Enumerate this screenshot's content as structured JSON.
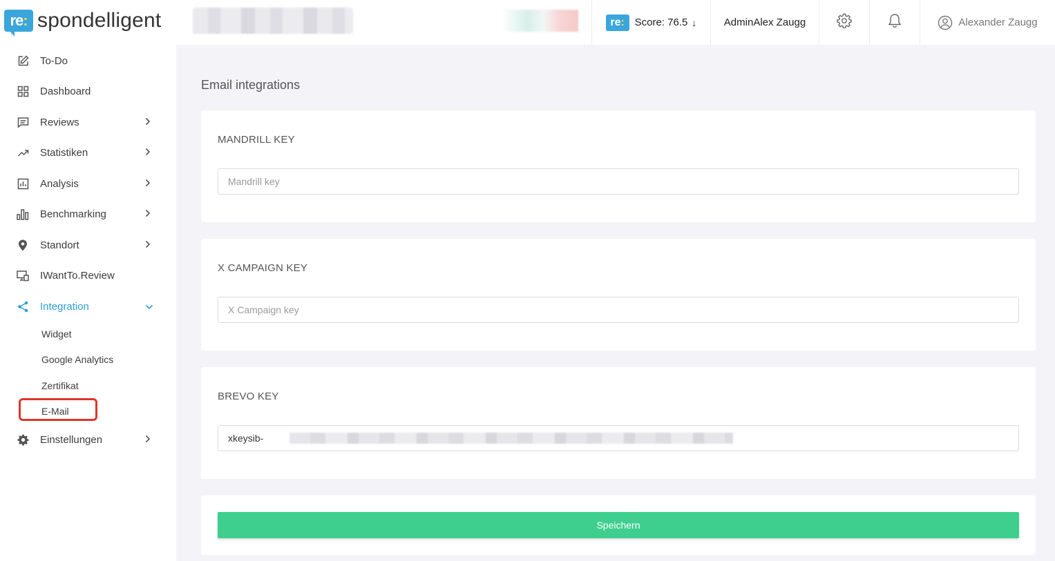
{
  "brand": {
    "badge_text": "re",
    "badge_colon": ":",
    "name": "spondelligent"
  },
  "sidebar": {
    "items": [
      {
        "label": "To-Do",
        "icon": "edit-icon"
      },
      {
        "label": "Dashboard",
        "icon": "grid-icon"
      },
      {
        "label": "Reviews",
        "icon": "comment-icon"
      },
      {
        "label": "Statistiken",
        "icon": "trend-icon"
      },
      {
        "label": "Analysis",
        "icon": "chart-box-icon"
      },
      {
        "label": "Benchmarking",
        "icon": "bar-chart-icon"
      },
      {
        "label": "Standort",
        "icon": "pin-icon"
      },
      {
        "label": "IWantTo.Review",
        "icon": "monitor-icon"
      },
      {
        "label": "Integration",
        "icon": "share-icon",
        "active": true
      },
      {
        "label": "Einstellungen",
        "icon": "gear-icon"
      }
    ],
    "sub_items": [
      {
        "label": "Widget"
      },
      {
        "label": "Google Analytics"
      },
      {
        "label": "Zertifikat"
      },
      {
        "label": "E-Mail",
        "highlighted": true
      }
    ]
  },
  "topbar": {
    "score_label": "Score: 76.5",
    "score_arrow": "↓",
    "admin_label": "AdminAlex Zaugg",
    "user_name": "Alexander Zaugg"
  },
  "main": {
    "title": "Email integrations",
    "cards": [
      {
        "label": "MANDRILL KEY",
        "placeholder": "Mandrill key",
        "value": ""
      },
      {
        "label": "X CAMPAIGN KEY",
        "placeholder": "X Campaign key",
        "value": ""
      },
      {
        "label": "BREVO KEY",
        "placeholder": "",
        "value": "xkeysib-"
      }
    ],
    "save_label": "Speichern"
  },
  "colors": {
    "accent": "#2b9fd9",
    "save": "#3ecf8e",
    "highlight": "#e0352b",
    "brand": "#3aa6dc"
  }
}
